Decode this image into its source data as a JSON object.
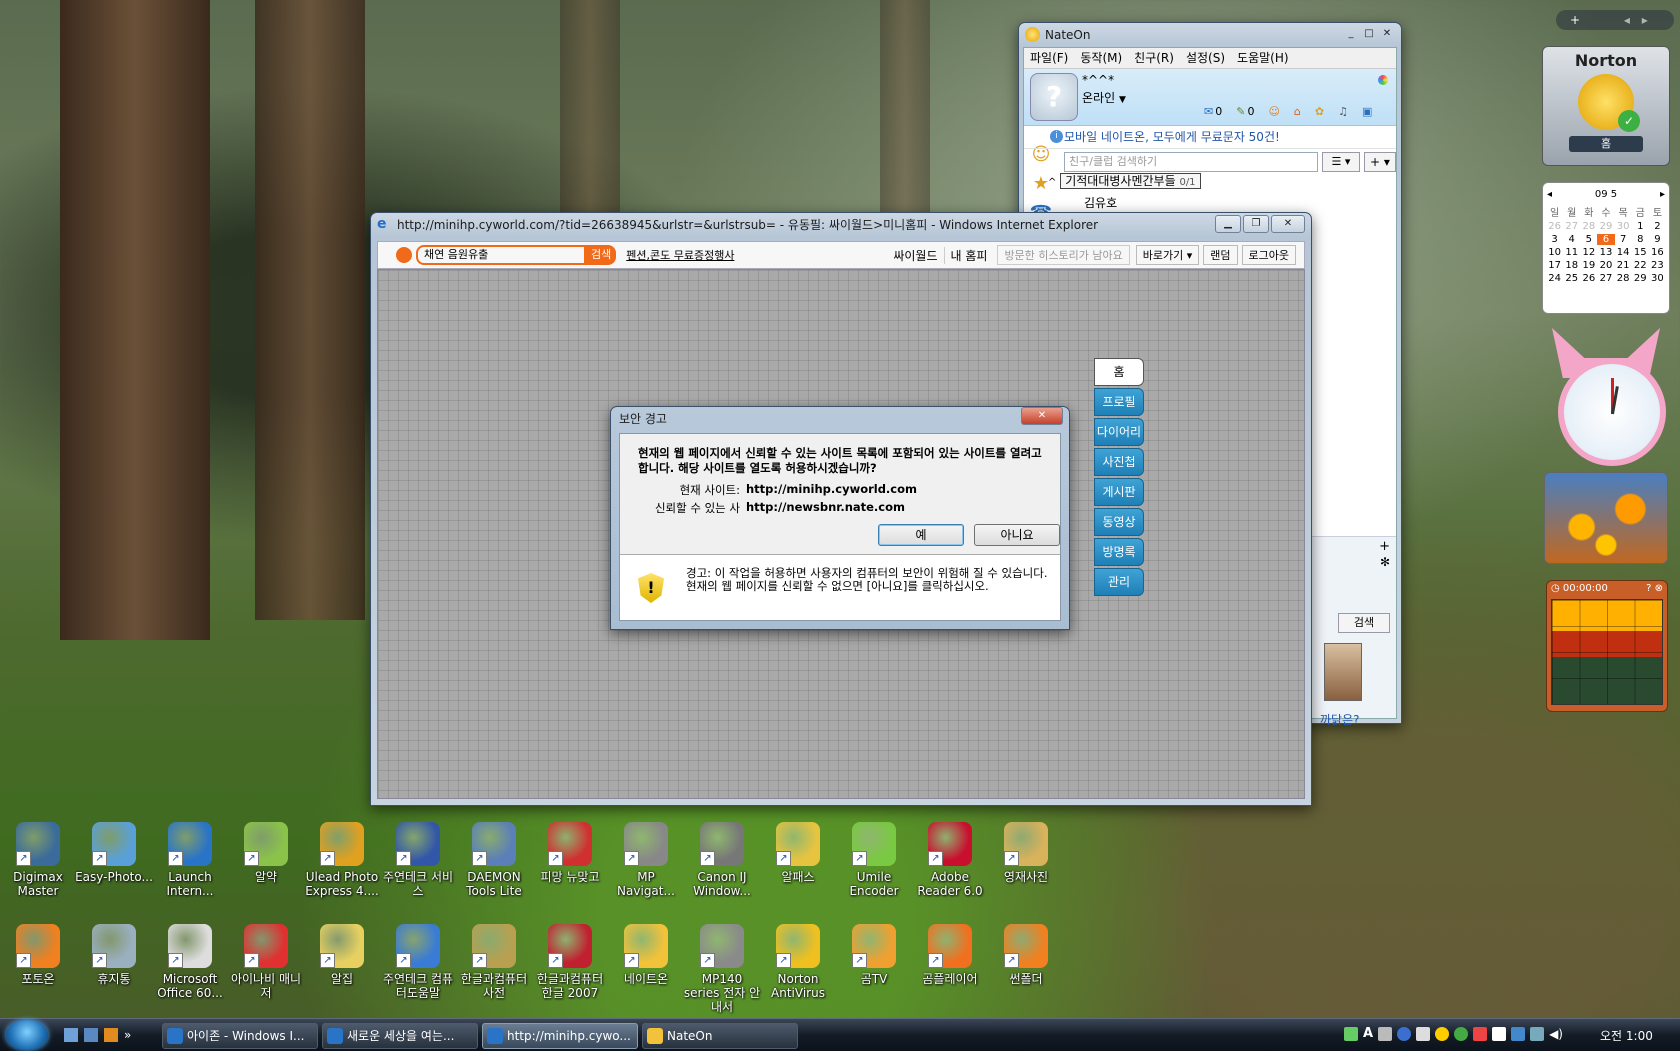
{
  "desktop": {
    "icons_row1": [
      {
        "label": "Digimax Master",
        "color": "#3a6b9a"
      },
      {
        "label": "Easy-Photo...",
        "color": "#5aa0d8"
      },
      {
        "label": "Launch Intern...",
        "color": "#2a74c8"
      },
      {
        "label": "알약",
        "color": "#8bc34a"
      },
      {
        "label": "Ulead Photo Express 4....",
        "color": "#e0a020"
      },
      {
        "label": "주연테크 서비스",
        "color": "#3357a8"
      },
      {
        "label": "DAEMON Tools Lite",
        "color": "#5b7fb8"
      },
      {
        "label": "피망 뉴맞고",
        "color": "#d03030"
      },
      {
        "label": "MP Navigat...",
        "color": "#888888"
      },
      {
        "label": "Canon IJ Window...",
        "color": "#777777"
      },
      {
        "label": "알패스",
        "color": "#e7c440"
      },
      {
        "label": "Umile Encoder",
        "color": "#7ac943"
      },
      {
        "label": "Adobe Reader 6.0",
        "color": "#c8102e"
      },
      {
        "label": "영재사진",
        "color": "#d9b25c"
      }
    ],
    "icons_row2": [
      {
        "label": "포토온",
        "color": "#f08020"
      },
      {
        "label": "휴지통",
        "color": "#9ab0c0"
      },
      {
        "label": "Microsoft Office 60...",
        "color": "#dddddd"
      },
      {
        "label": "아이나비 매니저",
        "color": "#e03030"
      },
      {
        "label": "알집",
        "color": "#e7d060"
      },
      {
        "label": "주연테크 컴퓨터도움말",
        "color": "#3a7bd5"
      },
      {
        "label": "한글과컴퓨터 사전",
        "color": "#b8a050"
      },
      {
        "label": "한글과컴퓨터 한글 2007",
        "color": "#c02030"
      },
      {
        "label": "네이트온",
        "color": "#f2c23a"
      },
      {
        "label": "MP140 series 전자 안내서",
        "color": "#8a8a8a"
      },
      {
        "label": "Norton AntiVirus",
        "color": "#f0c020"
      },
      {
        "label": "곰TV",
        "color": "#f0a030"
      },
      {
        "label": "곰플레이어",
        "color": "#f07020"
      },
      {
        "label": "썬폴더",
        "color": "#f08020"
      }
    ]
  },
  "nateon": {
    "title": "NateOn",
    "menu": [
      "파일(F)",
      "동작(M)",
      "친구(R)",
      "설정(S)",
      "도움말(H)"
    ],
    "nickname": "*^^*",
    "status": "온라인",
    "msg_count": "0",
    "note_count": "0",
    "notice": "모바일 네이트온, 모두에게 무료문자 50건!",
    "search_placeholder": "친구/클럽 검색하기",
    "group_name": "기적대대병사멘간부들",
    "group_count": "0/1",
    "friend_partial": "김유호",
    "search_button": "검색",
    "bottom_text": "까닭은?"
  },
  "ie": {
    "title": "http://minihp.cyworld.com/?tid=26638945&urlstr=&urlstrsub= - 유동필: 싸이월드>미니홈피 - Windows Internet Explorer",
    "search_value": "채연 음원유출",
    "search_button": "검색",
    "promo_link": "펜션,콘도 무료증정행사",
    "nav": [
      "싸이월드",
      "내 홈피"
    ],
    "history_text": "방문한 히스토리가 남아요",
    "goto_label": "바로가기",
    "random_label": "랜덤",
    "logout_label": "로그아웃",
    "tabs": [
      "홈",
      "프로필",
      "다이어리",
      "사진첩",
      "게시판",
      "동영상",
      "방명록",
      "관리"
    ]
  },
  "dialog": {
    "title": "보안 경고",
    "message": "현재의 웹 페이지에서 신뢰할 수 있는 사이트 목록에 포함되어 있는 사이트를 열려고 합니다. 해당 사이트를 열도록 허용하시겠습니까?",
    "current_label": "현재 사이트:",
    "current_value": "http://minihp.cyworld.com",
    "trusted_label": "신뢰할 수 있는 사",
    "trusted_value": "http://newsbnr.nate.com",
    "yes": "예",
    "no": "아니요",
    "warning": "경고: 이 작업을 허용하면 사용자의 컴퓨터의 보안이 위험해 질 수 있습니다. 현재의 웹 페이지를 신뢰할 수 없으면 [아니요]를 클릭하십시오."
  },
  "gadgets": {
    "norton_title": "Norton",
    "norton_button": "홈",
    "calendar_month": "09 5",
    "calendar_weekdays": [
      "일",
      "월",
      "화",
      "수",
      "목",
      "금",
      "토"
    ],
    "calendar_rows": [
      [
        "26",
        "27",
        "28",
        "29",
        "30",
        "1",
        "2"
      ],
      [
        "3",
        "4",
        "5",
        "6",
        "7",
        "8",
        "9"
      ],
      [
        "10",
        "11",
        "12",
        "13",
        "14",
        "15",
        "16"
      ],
      [
        "17",
        "18",
        "19",
        "20",
        "21",
        "22",
        "23"
      ],
      [
        "24",
        "25",
        "26",
        "27",
        "28",
        "29",
        "30"
      ]
    ],
    "calendar_today": "6",
    "timer": "00:00:00"
  },
  "taskbar": {
    "tasks": [
      "아이존 - Windows I...",
      "새로운 세상을 여는...",
      "http://minihp.cywo...",
      "NateOn"
    ],
    "active_index": 2,
    "clock": "오전 1:00"
  }
}
